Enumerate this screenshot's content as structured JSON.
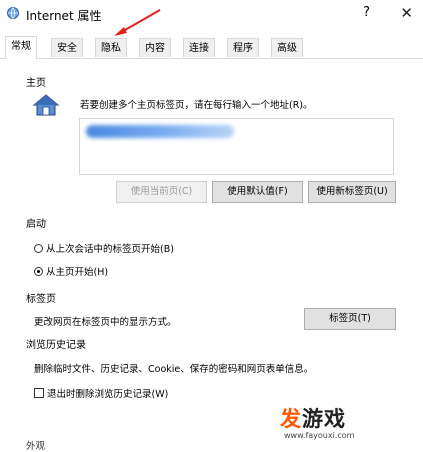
{
  "window": {
    "title": "Internet 属性",
    "help": "?",
    "close": "✕"
  },
  "tabs": [
    {
      "label": "常规",
      "active": true
    },
    {
      "label": "安全",
      "active": false
    },
    {
      "label": "隐私",
      "active": false
    },
    {
      "label": "内容",
      "active": false
    },
    {
      "label": "连接",
      "active": false
    },
    {
      "label": "程序",
      "active": false
    },
    {
      "label": "高级",
      "active": false
    }
  ],
  "home": {
    "section": "主页",
    "description": "若要创建多个主页标签页，请在每行输入一个地址(R)。",
    "buttons": {
      "use_current": "使用当前页(C)",
      "use_default": "使用默认值(F)",
      "use_new_tab": "使用新标签页(U)"
    }
  },
  "startup": {
    "section": "启动",
    "option1": "从上次会话中的标签页开始(B)",
    "option2": "从主页开始(H)",
    "selected": "option2"
  },
  "tabs_section": {
    "section": "标签页",
    "description": "更改网页在标签页中的显示方式。",
    "button": "标签页(T)"
  },
  "history": {
    "section": "浏览历史记录",
    "description": "删除临时文件、历史记录、Cookie、保存的密码和网页表单信息。",
    "checkbox": "退出时删除浏览历史记录(W)",
    "checked": false
  },
  "bottom_partial": "外观",
  "watermark": {
    "brand_first": "发",
    "brand_rest": "游戏",
    "url": "www.fayouxi.com"
  }
}
